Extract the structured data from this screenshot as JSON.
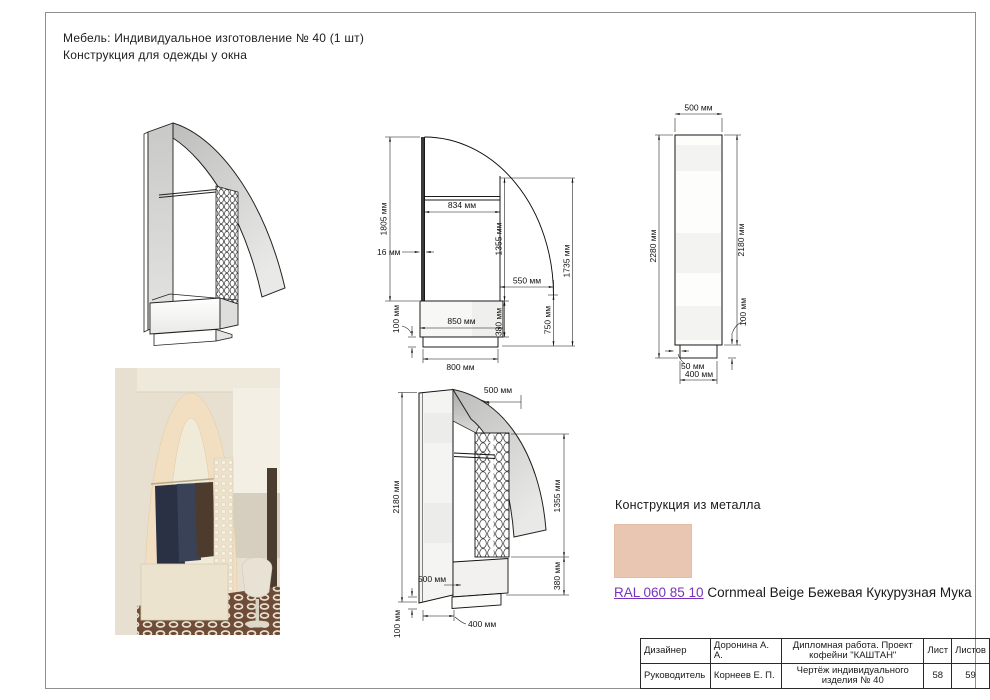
{
  "header": {
    "line1": "Мебель: Индивидуальное изготовление № 40 (1 шт)",
    "line2": "Конструкция для одежды у окна"
  },
  "front_view": {
    "d1805": "1805 мм",
    "d16": "16 мм",
    "d834": "834 мм",
    "d100": "100 мм",
    "d850": "850 мм",
    "d800": "800 мм",
    "d380": "380 мм",
    "d1355": "1355 мм",
    "d550": "550 мм",
    "d750": "750 мм",
    "d1735": "1735 мм"
  },
  "side_view": {
    "d500": "500 мм",
    "d2280": "2280 мм",
    "d2180": "2180 мм",
    "d100": "100 мм",
    "d50": "50 мм",
    "d400": "400 мм"
  },
  "iso_view": {
    "d500_top": "500 мм",
    "d2180": "2180 мм",
    "d1355": "1355 мм",
    "d380": "380 мм",
    "d500_side": "500 мм",
    "d100": "100 мм",
    "d400": "400 мм"
  },
  "material": {
    "label": "Конструкция из металла",
    "swatch_color": "#E9C6B2",
    "ral_code": "RAL 060 85 10",
    "ral_name": "Cornmeal Beige Бежевая Кукурузная Мука"
  },
  "title_block": {
    "designer_label": "Дизайнер",
    "designer_name": "Доронина А. А.",
    "project_title": "Дипломная работа. Проект кофейни \"КАШТАН\"",
    "sheet_label": "Лист",
    "sheets_label": "Листов",
    "supervisor_label": "Руководитель",
    "supervisor_name": "Корнеев Е. П.",
    "drawing_title": "Чертёж индивидуального изделия № 40",
    "sheet_number": "58",
    "sheets_total": "59"
  }
}
